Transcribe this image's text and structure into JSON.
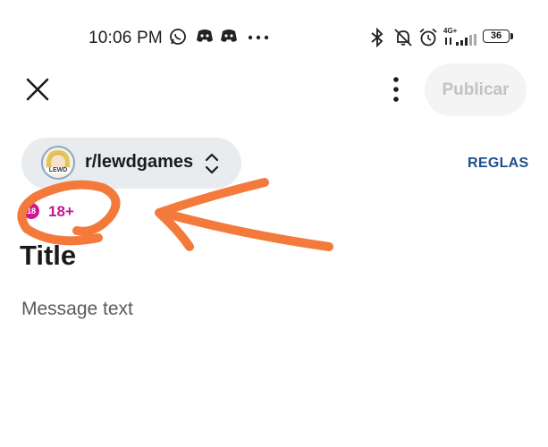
{
  "status_bar": {
    "time": "10:06 PM",
    "network": "4G+",
    "battery": "36",
    "icons": [
      "whatsapp-icon",
      "discord-icon",
      "discord-icon",
      "more-dots-icon",
      "bluetooth-icon",
      "bell-off-icon",
      "alarm-icon",
      "signal-icon",
      "battery-icon"
    ]
  },
  "toolbar": {
    "close_icon": "close-icon",
    "more_icon": "vertical-dots-icon",
    "publish_label": "Publicar"
  },
  "community": {
    "name": "r/lewdgames",
    "avatar_text": "LEWD",
    "rules_label": "REGLAS"
  },
  "tag": {
    "icon_text": "18",
    "label": "18+",
    "color": "#c6168c"
  },
  "post": {
    "title_placeholder": "Title",
    "body_placeholder": "Message text"
  },
  "colors": {
    "annotation": "#f47a3c",
    "link": "#1c4f8c",
    "publish_disabled_bg": "#f4f4f5",
    "publish_disabled_text": "#c2c2c6",
    "pill_bg": "#e9ecef"
  }
}
